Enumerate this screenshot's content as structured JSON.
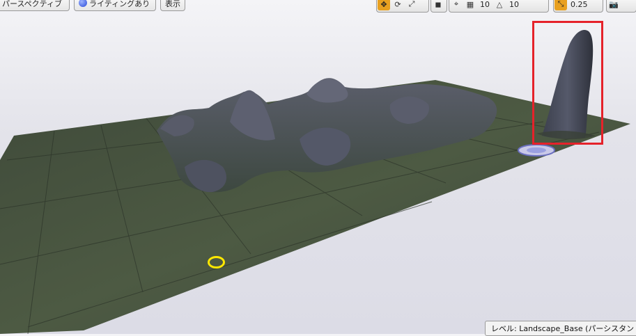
{
  "toolbar": {
    "perspective_label": "パースペクティブ",
    "lighting_label": "ライティングあり",
    "show_label": "表示",
    "grid_snap_value": "10",
    "rotation_snap_value": "10",
    "scale_snap_value": "0.25",
    "icons": [
      "translate-icon",
      "rotate-icon",
      "scale-icon",
      "world-local-icon",
      "surface-snap-icon",
      "grid-icon",
      "rotation-icon",
      "scale-snap-icon",
      "camera-speed-icon"
    ]
  },
  "status_bar": {
    "level_text": "レベル:  Landscape_Base (パーシスタン"
  },
  "colors": {
    "highlight_box": "#e5222a",
    "marker_ring": "#ffe800",
    "active_tool": "#e8a020"
  }
}
